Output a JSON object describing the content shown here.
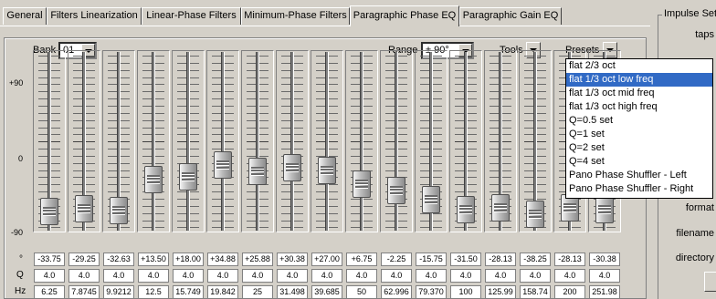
{
  "tabs": [
    {
      "label": "General",
      "active": false
    },
    {
      "label": "Filters Linearization",
      "active": false
    },
    {
      "label": "Linear-Phase Filters",
      "active": false
    },
    {
      "label": "Minimum-Phase Filters",
      "active": false
    },
    {
      "label": "Paragraphic Phase EQ",
      "active": true
    },
    {
      "label": "Paragraphic Gain EQ",
      "active": false
    }
  ],
  "controls": {
    "bank_label": "Bank",
    "bank_value": "01",
    "range_label": "Range",
    "range_value": "± 90°",
    "tools_label": "Tools",
    "presets_label": "Presets"
  },
  "scale": {
    "top": "+90",
    "mid": "0",
    "bottom": "-90"
  },
  "row_labels": {
    "phase": "°",
    "q": "Q",
    "hz": "Hz"
  },
  "bands": [
    {
      "phase": "-33.75",
      "q": "4.0",
      "hz": "6.25",
      "level": -33.75
    },
    {
      "phase": "-29.25",
      "q": "4.0",
      "hz": "7.8745",
      "level": -29.25
    },
    {
      "phase": "-32.63",
      "q": "4.0",
      "hz": "9.9212",
      "level": -32.63
    },
    {
      "phase": "+13.50",
      "q": "4.0",
      "hz": "12.5",
      "level": 13.5
    },
    {
      "phase": "+18.00",
      "q": "4.0",
      "hz": "15.749",
      "level": 18.0
    },
    {
      "phase": "+34.88",
      "q": "4.0",
      "hz": "19.842",
      "level": 34.88
    },
    {
      "phase": "+25.88",
      "q": "4.0",
      "hz": "25",
      "level": 25.88
    },
    {
      "phase": "+30.38",
      "q": "4.0",
      "hz": "31.498",
      "level": 30.38
    },
    {
      "phase": "+27.00",
      "q": "4.0",
      "hz": "39.685",
      "level": 27.0
    },
    {
      "phase": "+6.75",
      "q": "4.0",
      "hz": "50",
      "level": 6.75
    },
    {
      "phase": "-2.25",
      "q": "4.0",
      "hz": "62.996",
      "level": -2.25
    },
    {
      "phase": "-15.75",
      "q": "4.0",
      "hz": "79.370",
      "level": -15.75
    },
    {
      "phase": "-31.50",
      "q": "4.0",
      "hz": "100",
      "level": -31.5
    },
    {
      "phase": "-28.13",
      "q": "4.0",
      "hz": "125.99",
      "level": -28.13
    },
    {
      "phase": "-38.25",
      "q": "4.0",
      "hz": "158.74",
      "level": -38.25
    },
    {
      "phase": "-28.13",
      "q": "4.0",
      "hz": "200",
      "level": -28.13
    },
    {
      "phase": "-30.38",
      "q": "4.0",
      "hz": "251.98",
      "level": -30.38
    }
  ],
  "presets_menu": {
    "items": [
      "flat 2/3 oct",
      "flat 1/3 oct low freq",
      "flat 1/3 oct mid freq",
      "flat 1/3 oct high freq",
      "Q=0.5 set",
      "Q=1 set",
      "Q=2 set",
      "Q=4 set",
      "Pano Phase Shuffler - Left",
      "Pano Phase Shuffler - Right"
    ],
    "selected_index": 1
  },
  "right_panel": {
    "title": "Impulse Setti",
    "labels": [
      "taps",
      "format",
      "filename",
      "directory"
    ]
  }
}
